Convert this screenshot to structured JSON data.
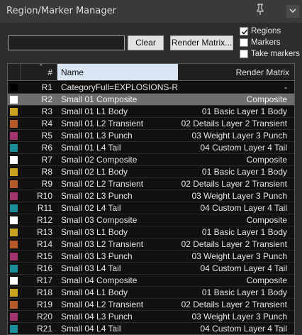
{
  "window": {
    "title": "Region/Marker Manager"
  },
  "toolbar": {
    "search_value": "",
    "clear_label": "Clear",
    "render_matrix_label": "Render Matrix..."
  },
  "filters": [
    {
      "label": "Regions",
      "checked": true
    },
    {
      "label": "Markers",
      "checked": false
    },
    {
      "label": "Take markers",
      "checked": false
    }
  ],
  "table": {
    "columns": {
      "color": "",
      "number": "#",
      "name": "Name",
      "render_matrix": "Render Matrix"
    },
    "rows": [
      {
        "num": "R1",
        "name": "CategoryFull=EXPLOSIONS-RE...",
        "rm": "-",
        "color": "#000000",
        "selected": false
      },
      {
        "num": "R2",
        "name": "Small 01 Composite",
        "rm": "Composite",
        "color": "#ffffff",
        "selected": true
      },
      {
        "num": "R3",
        "name": "Small 01 L1 Body",
        "rm": "01 Basic Layer 1 Body",
        "color": "#c8a21e",
        "selected": false
      },
      {
        "num": "R4",
        "name": "Small 01 L2 Transient",
        "rm": "02 Details Layer 2 Transient",
        "color": "#b65a2a",
        "selected": false
      },
      {
        "num": "R5",
        "name": "Small 01 L3 Punch",
        "rm": "03 Weight Layer 3 Punch",
        "color": "#a3356e",
        "selected": false
      },
      {
        "num": "R6",
        "name": "Small 01 L4 Tail",
        "rm": "04 Custom Layer 4 Tail",
        "color": "#1a8d9a",
        "selected": false
      },
      {
        "num": "R7",
        "name": "Small 02 Composite",
        "rm": "Composite",
        "color": "#ffffff",
        "selected": false
      },
      {
        "num": "R8",
        "name": "Small 02 L1 Body",
        "rm": "01 Basic Layer 1 Body",
        "color": "#c8a21e",
        "selected": false
      },
      {
        "num": "R9",
        "name": "Small 02 L2 Transient",
        "rm": "02 Details Layer 2 Transient",
        "color": "#b65a2a",
        "selected": false
      },
      {
        "num": "R10",
        "name": "Small 02 L3 Punch",
        "rm": "03 Weight Layer 3 Punch",
        "color": "#a3356e",
        "selected": false
      },
      {
        "num": "R11",
        "name": "Small 02 L4 Tail",
        "rm": "04 Custom Layer 4 Tail",
        "color": "#1a8d9a",
        "selected": false
      },
      {
        "num": "R12",
        "name": "Small 03 Composite",
        "rm": "Composite",
        "color": "#ffffff",
        "selected": false
      },
      {
        "num": "R13",
        "name": "Small 03 L1 Body",
        "rm": "01 Basic Layer 1 Body",
        "color": "#c8a21e",
        "selected": false
      },
      {
        "num": "R14",
        "name": "Small 03 L2 Transient",
        "rm": "02 Details Layer 2 Transient",
        "color": "#b65a2a",
        "selected": false
      },
      {
        "num": "R15",
        "name": "Small 03 L3 Punch",
        "rm": "03 Weight Layer 3 Punch",
        "color": "#a3356e",
        "selected": false
      },
      {
        "num": "R16",
        "name": "Small 03 L4 Tail",
        "rm": "04 Custom Layer 4 Tail",
        "color": "#1a8d9a",
        "selected": false
      },
      {
        "num": "R17",
        "name": "Small 04 Composite",
        "rm": "Composite",
        "color": "#ffffff",
        "selected": false
      },
      {
        "num": "R18",
        "name": "Small 04 L1 Body",
        "rm": "01 Basic Layer 1 Body",
        "color": "#c8a21e",
        "selected": false
      },
      {
        "num": "R19",
        "name": "Small 04 L2 Transient",
        "rm": "02 Details Layer 2 Transient",
        "color": "#b65a2a",
        "selected": false
      },
      {
        "num": "R20",
        "name": "Small 04 L3 Punch",
        "rm": "03 Weight Layer 3 Punch",
        "color": "#a3356e",
        "selected": false
      },
      {
        "num": "R21",
        "name": "Small 04 L4 Tail",
        "rm": "04 Custom Layer 4 Tail",
        "color": "#1a8d9a",
        "selected": false
      }
    ]
  },
  "icons": {
    "pin": "pin-icon",
    "close": "close-icon",
    "sort": "sort-ascending-icon",
    "check": "checkmark-icon"
  }
}
